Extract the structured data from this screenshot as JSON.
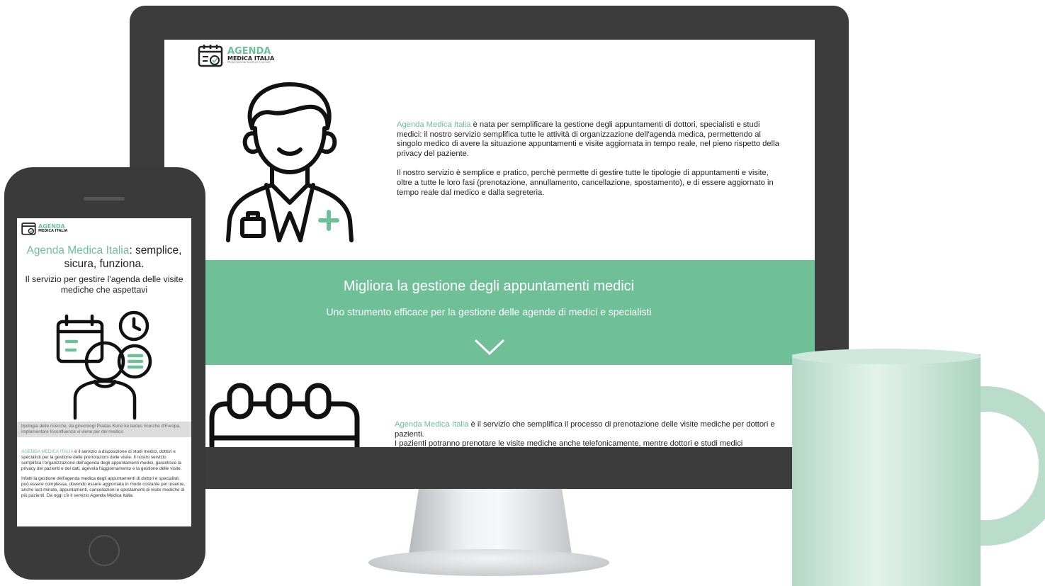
{
  "brand": {
    "line1": "AGENDA",
    "line2": "MEDICA ITALIA",
    "tagline": "PRENOTAZIONI SEMPLICI E SICURE",
    "accent": "#6fbf98"
  },
  "desktop": {
    "intro_p1_highlight": "Agenda Medica Italia",
    "intro_p1_rest": " è nata per semplificare la gestione degli appuntamenti di dottori, specialisti e studi medici: il nostro servizio semplifica tutte le attività di organizzazione dell'agenda medica, permettendo al singolo medico di avere la situazione appuntamenti e visite aggiornata in tempo reale, nel pieno rispetto della privacy del paziente.",
    "intro_p2": "Il nostro servizio è semplice e pratico, perchè permette di gestire tutte le tipologie di appuntamenti e visite, oltre a tutte le loro fasi (prenotazione, annullamento, cancellazione, spostamento), e di essere aggiornato in tempo reale dal medico e dalla segreteria.",
    "band_title": "Migliora la gestione degli appuntamenti medici",
    "band_subtitle": "Uno strumento efficace per la gestione delle agende di medici e specialisti",
    "section2_highlight": "Agenda Medica Italia",
    "section2_rest": " è il servizio che semplifica il processo di prenotazione delle visite mediche per dottori e pazienti.",
    "section2_line2": "I pazienti potranno prenotare le visite mediche anche telefonicamente, mentre dottori e studi medici"
  },
  "mobile": {
    "title_highlight": "Agenda Medica Italia",
    "title_rest": ": semplice, sicura, funziona.",
    "subtitle": "Il servizio per gestire l'agenda delle visite mediche che aspettavi",
    "caption": "tipologia delle ricerche, da ginecologi Pradas Kuno ke lardes ricerche d'Europa, implementare Inconfluenza vi viene per del medico",
    "p1_highlight": "AGENDA MEDICA ITALIA",
    "p1_rest": " è il servizio a disposizione di studi medici, dottori e specialisti per la gestione delle prenotazioni delle visite. Il nostro servizio semplifica l'organizzazione dell'agenda degli appuntamenti medici, garantisce la privacy dei pazienti e dei dati, agevola l'aggiornamento e la gestione delle visite.",
    "p2": "Infatti la gestione dell'agenda medica degli appuntamenti di dottori e specialisti, può essere complessa, dovendo essere aggiornata in modo costante per inserire, anche last-minute, appuntamenti, cancellazioni e spostamenti di visite mediche di più pazienti. Da oggi c'è il servizio Agenda Medica Italia."
  },
  "icons": {
    "logo": "calendar-check-icon",
    "doctor": "doctor-icon",
    "calendar": "calendar-icon",
    "scroll": "chevron-down-icon",
    "mobile_illustration": "patient-calendar-clock-list-icon"
  }
}
